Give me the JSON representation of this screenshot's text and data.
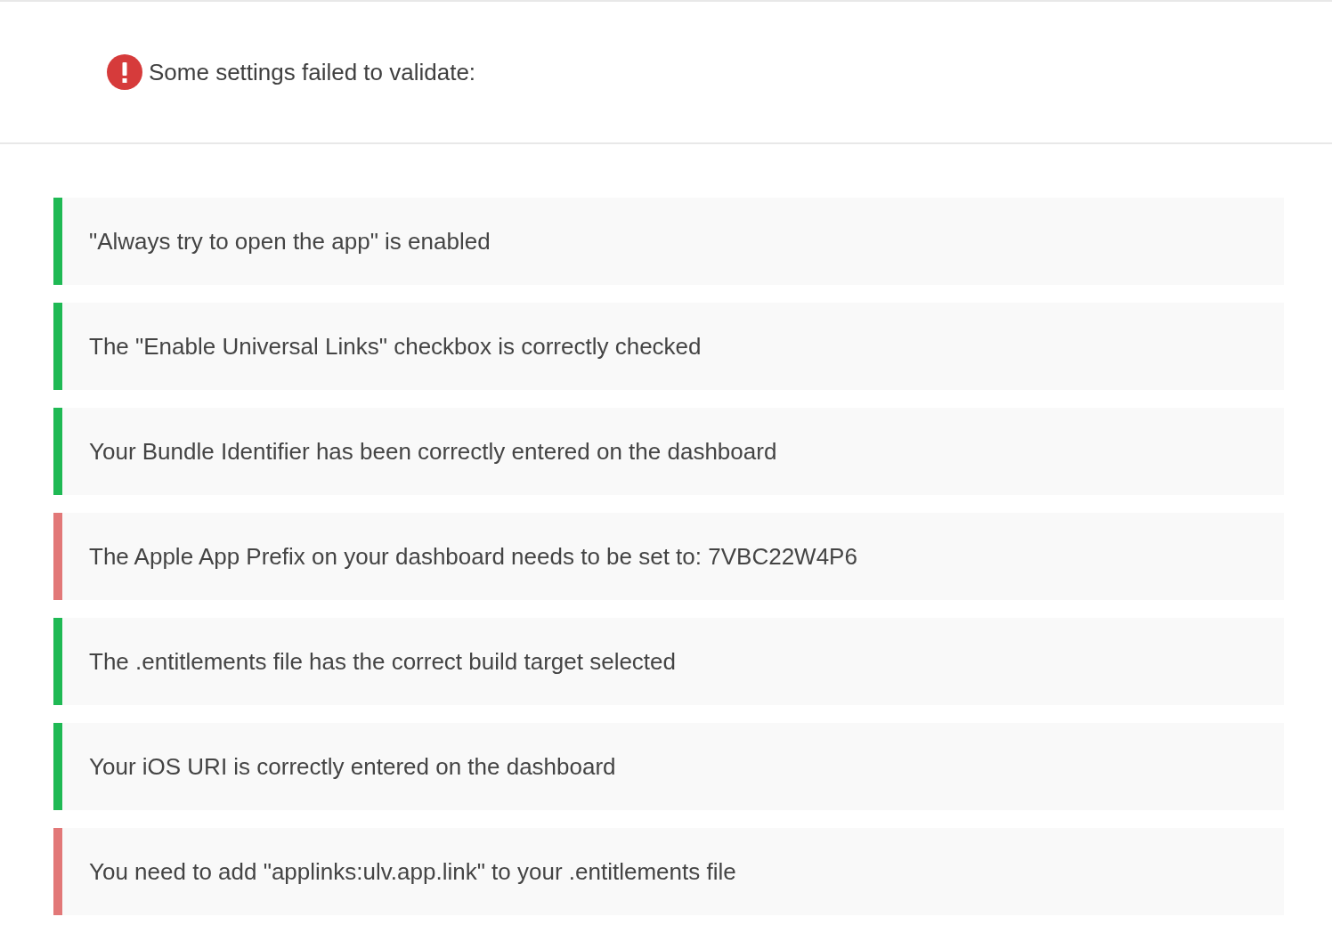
{
  "header": {
    "message": "Some settings failed to validate:"
  },
  "checks": [
    {
      "message": "\"Always try to open the app\" is enabled",
      "passed": true
    },
    {
      "message": "The \"Enable Universal Links\" checkbox is correctly checked",
      "passed": true
    },
    {
      "message": "Your Bundle Identifier has been correctly entered on the dashboard",
      "passed": true
    },
    {
      "message": "The Apple App Prefix on your dashboard needs to be set to: 7VBC22W4P6",
      "passed": false
    },
    {
      "message": "The .entitlements file has the correct build target selected",
      "passed": true
    },
    {
      "message": "Your iOS URI is correctly entered on the dashboard",
      "passed": true
    },
    {
      "message": "You need to add \"applinks:ulv.app.link\" to your .entitlements file",
      "passed": false
    }
  ]
}
